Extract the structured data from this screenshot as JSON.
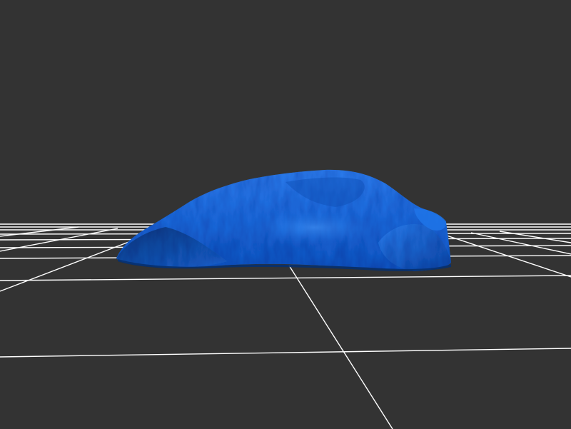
{
  "viewer": {
    "background_color": "#333333",
    "grid_color": "#ffffff",
    "model_color": "#1a6fe0",
    "model_highlight_color": "#3d92ff",
    "model_shadow_color": "#0b3f8a",
    "grid_visible": true
  }
}
